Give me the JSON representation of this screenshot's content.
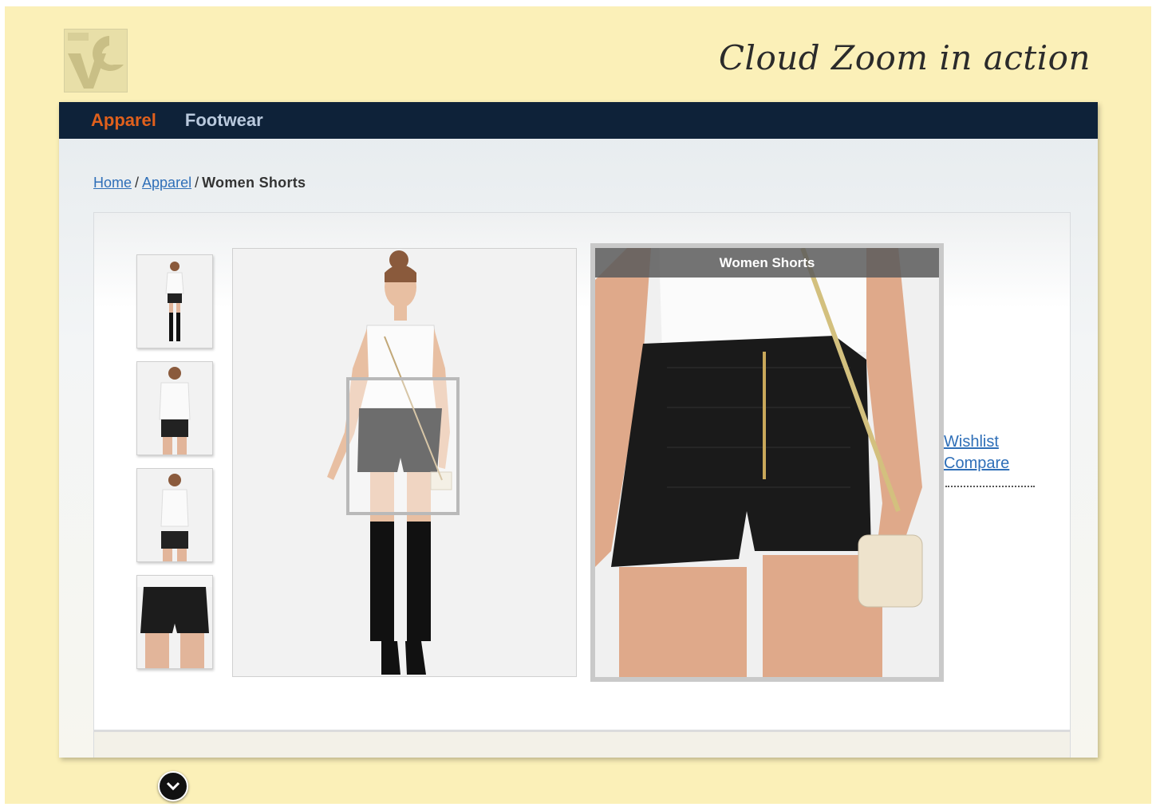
{
  "headline": "Cloud Zoom in action",
  "nav": {
    "items": [
      "Apparel",
      "Footwear"
    ],
    "active": "Apparel"
  },
  "breadcrumb": {
    "home": "Home",
    "category": "Apparel",
    "current": "Women Shorts",
    "separator": "/"
  },
  "zoom": {
    "title": "Women Shorts"
  },
  "product_links": {
    "wishlist": "Wishlist",
    "compare": "Compare"
  },
  "colors": {
    "background": "#fbf0b8",
    "nav_bg": "#0e2239",
    "nav_active": "#e0601c",
    "nav_inactive": "#b9c9dd",
    "link": "#2f6fb8"
  }
}
